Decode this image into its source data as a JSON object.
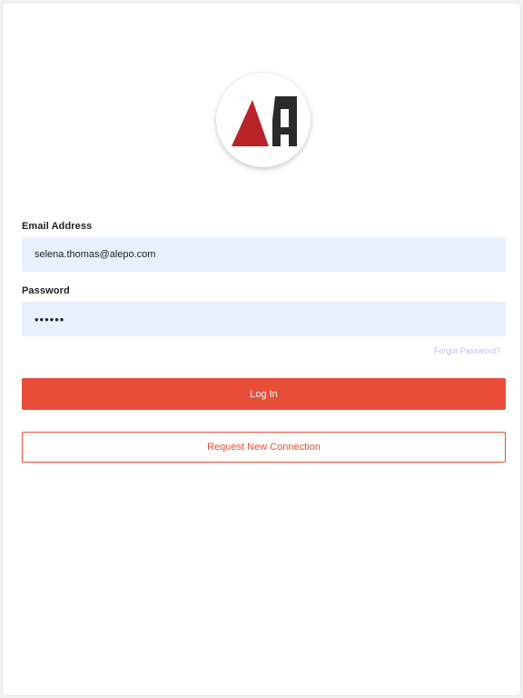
{
  "logo": {
    "icon": "alepo-logo-icon",
    "colors": {
      "red": "#b8232a",
      "dark": "#2b2b2b"
    }
  },
  "form": {
    "email_label": "Email Address",
    "email_value": "selena.thomas@alepo.com",
    "password_label": "Password",
    "password_value": "••••••",
    "forgot_link": "Forgot Password?",
    "login_button": "Log In",
    "request_button": "Request New Connection"
  },
  "colors": {
    "accent": "#e84e3a",
    "input_background": "#e8f0fe",
    "link": "#b9c3e6"
  }
}
